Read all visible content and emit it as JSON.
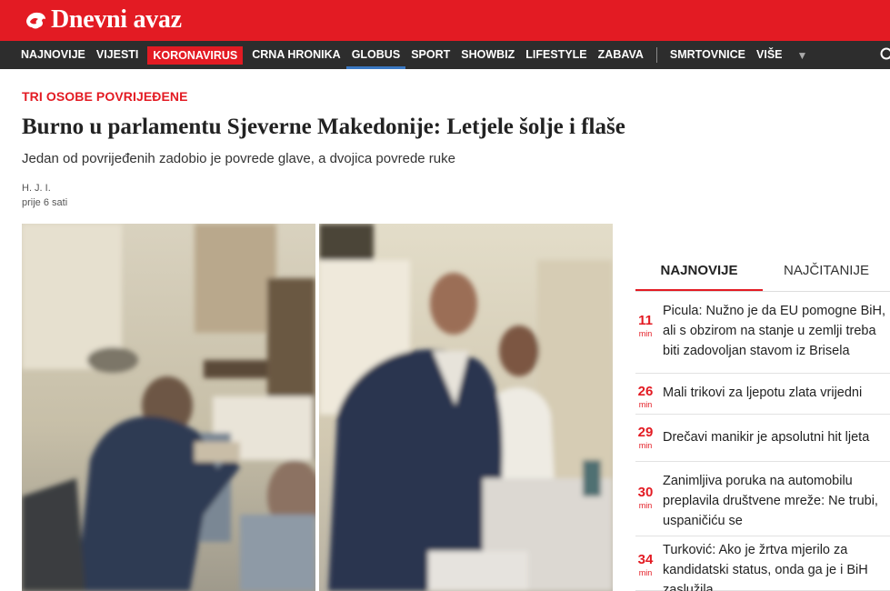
{
  "brand": {
    "name": "Dnevni avaz"
  },
  "nav": {
    "items": [
      {
        "label": "NAJNOVIJE",
        "style": ""
      },
      {
        "label": "VIJESTI",
        "style": ""
      },
      {
        "label": "KORONAVIRUS",
        "style": "highlight"
      },
      {
        "label": "CRNA HRONIKA",
        "style": ""
      },
      {
        "label": "GLOBUS",
        "style": "active"
      },
      {
        "label": "SPORT",
        "style": ""
      },
      {
        "label": "SHOWBIZ",
        "style": ""
      },
      {
        "label": "LIFESTYLE",
        "style": ""
      },
      {
        "label": "ZABAVA",
        "style": ""
      },
      {
        "label": "SMRTOVNICE",
        "style": "after-sep"
      },
      {
        "label": "VIŠE",
        "style": ""
      }
    ],
    "more_icon": "chevron-down-icon",
    "search_icon": "search-icon"
  },
  "article": {
    "kicker": "TRI OSOBE POVRIJEĐENE",
    "title": "Burno u parlamentu Sjeverne Makedonije: Letjele šolje i flaše",
    "lead": "Jedan od povrijeđenih zadobio je povrede glave, a dvojica povrede ruke",
    "author": "H. J. I.",
    "time": "prije 6 sati"
  },
  "sidebar": {
    "tabs": [
      "NAJNOVIJE",
      "NAJČITANIJE"
    ],
    "items": [
      {
        "minutes": "11",
        "unit": "min",
        "title": "Picula: Nužno je da EU pomogne BiH, ali s obzirom na stanje u zemlji treba biti zadovoljan stavom iz Brisela"
      },
      {
        "minutes": "26",
        "unit": "min",
        "title": "Mali trikovi za ljepotu zlata vrijedni"
      },
      {
        "minutes": "29",
        "unit": "min",
        "title": "Drečavi manikir je apsolutni hit ljeta"
      },
      {
        "minutes": "30",
        "unit": "min",
        "title": "Zanimljiva poruka na automobilu preplavila društvene mreže: Ne trubi, uspaničiću se"
      },
      {
        "minutes": "34",
        "unit": "min",
        "title": "Turković: Ako je žrtva mjerilo za kandidatski status, onda ga je i BiH zaslužila"
      }
    ]
  },
  "colors": {
    "brand_red": "#e31b23",
    "nav_bg": "#2d2d2d",
    "active_blue": "#3a78c2"
  }
}
